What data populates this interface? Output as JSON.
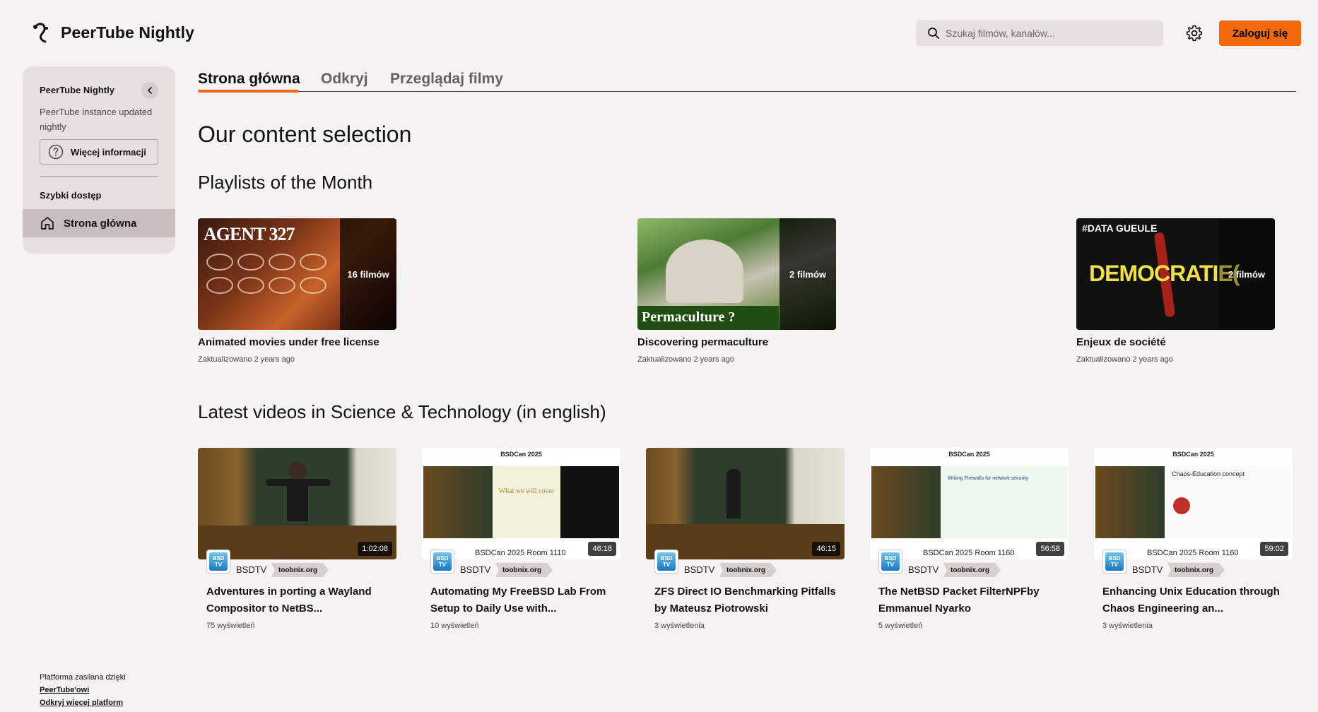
{
  "app": {
    "title": "PeerTube Nightly"
  },
  "search": {
    "placeholder": "Szukaj filmów, kanałów..."
  },
  "header": {
    "login_label": "Zaloguj się"
  },
  "sidebar": {
    "title": "PeerTube Nightly",
    "description": "PeerTube instance updated nightly",
    "more_info_label": "Więcej informacji",
    "quick_access_label": "Szybki dostęp",
    "home_label": "Strona główna"
  },
  "tabs": [
    {
      "label": "Strona główna",
      "active": true
    },
    {
      "label": "Odkryj",
      "active": false
    },
    {
      "label": "Przeglądaj filmy",
      "active": false
    }
  ],
  "main": {
    "heading": "Our content selection",
    "playlists_heading": "Playlists of the Month",
    "videos_heading": "Latest videos in Science & Technology (in english)"
  },
  "playlists": [
    {
      "title": "Animated movies under free license",
      "count": "16 filmów",
      "updated": "Zaktualizowano 2 years ago",
      "thumb_text": "AGENT 327"
    },
    {
      "title": "Discovering permaculture",
      "count": "2 filmów",
      "updated": "Zaktualizowano 2 years ago",
      "thumb_text": "Permaculture ?"
    },
    {
      "title": "Enjeux de société",
      "count": "2 filmów",
      "updated": "Zaktualizowano 2 years ago",
      "thumb_text": "DEMOCRATIE(",
      "thumb_tag": "#DATA GUEULE"
    }
  ],
  "videos": [
    {
      "title": "Adventures in porting a Wayland Compositor to NetBS...",
      "duration": "1:02:08",
      "channel": "BSDTV",
      "host": "toobnix.org",
      "views": "75 wyświetleń",
      "subtitle": ""
    },
    {
      "title": "Automating My FreeBSD Lab From Setup to Daily Use with...",
      "duration": "46:18",
      "channel": "BSDTV",
      "host": "toobnix.org",
      "views": "10 wyświetleń",
      "subtitle": "BSDCan 2025 Room 1110",
      "slide_header": "BSDCan 2025",
      "slide_text": "What we will cover"
    },
    {
      "title": "ZFS Direct IO Benchmarking Pitfalls by Mateusz Piotrowski",
      "duration": "46:15",
      "channel": "BSDTV",
      "host": "toobnix.org",
      "views": "3 wyświetlenia",
      "subtitle": ""
    },
    {
      "title": "The NetBSD Packet FilterNPFby Emmanuel Nyarko",
      "duration": "56:58",
      "channel": "BSDTV",
      "host": "toobnix.org",
      "views": "5 wyświetleń",
      "subtitle": "BSDCan 2025 Room 1160",
      "slide_header": "BSDCan 2025",
      "slide_text": "Writing Firewalls for network security"
    },
    {
      "title": "Enhancing Unix Education through Chaos Engineering an...",
      "duration": "59:02",
      "channel": "BSDTV",
      "host": "toobnix.org",
      "views": "3 wyświetlenia",
      "subtitle": "BSDCan 2025 Room 1160",
      "slide_header": "BSDCan 2025",
      "slide_text": "Chaos-Education concept"
    }
  ],
  "avatar_text": "BSD TV",
  "footer": {
    "powered_by": "Platforma zasilana dzięki",
    "peertube_link": "PeerTube'owi",
    "more_platforms_link": "Odkryj więcej platform"
  },
  "colors": {
    "accent": "#f2690d",
    "sidebar_bg": "#e9dfdf",
    "page_bg": "#f4f2f2"
  }
}
